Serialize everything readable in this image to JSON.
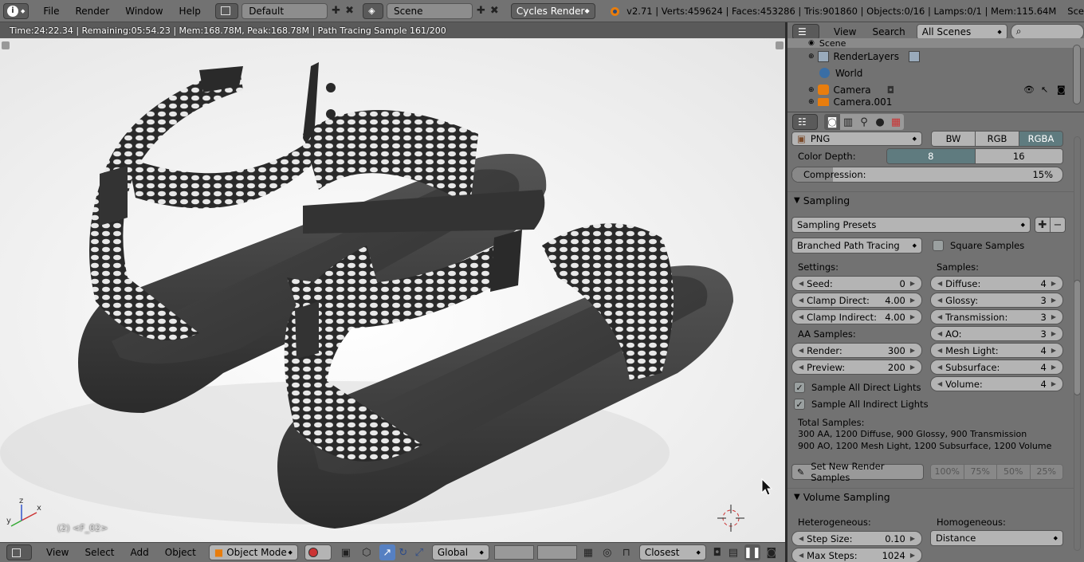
{
  "topbar": {
    "menus": [
      "File",
      "Render",
      "Window",
      "Help"
    ],
    "screen_layout": "Default",
    "scene": "Scene",
    "engine": "Cycles Render",
    "stats": "v2.71 | Verts:459624 | Faces:453286 | Tris:901860 | Objects:0/16 | Lamps:0/1 | Mem:115.64M",
    "right_cut": "Sce"
  },
  "viewport": {
    "info": "Time:24:22.34 | Remaining:05:54.23 | Mem:168.78M, Peak:168.78M | Path Tracing Sample 161/200",
    "object_label": "(2) <F_02>",
    "axis": {
      "x": "x",
      "y": "y",
      "z": "z"
    }
  },
  "footer": {
    "menus": [
      "View",
      "Select",
      "Add",
      "Object"
    ],
    "mode": "Object Mode",
    "orientation": "Global",
    "snap": "Closest"
  },
  "outliner": {
    "menus": [
      "View",
      "Search"
    ],
    "filter": "All Scenes",
    "rows": [
      "Scene",
      "RenderLayers",
      "World",
      "Camera",
      "Camera.001"
    ]
  },
  "properties": {
    "format": "PNG",
    "color_modes": [
      "BW",
      "RGB",
      "RGBA"
    ],
    "color_depth_label": "Color Depth:",
    "color_depths": [
      "8",
      "16"
    ],
    "compression_label": "Compression:",
    "compression_value": "15%",
    "sampling": {
      "title": "Sampling",
      "presets": "Sampling Presets",
      "method": "Branched Path Tracing",
      "square_samples": "Square Samples",
      "settings_label": "Settings:",
      "samples_label": "Samples:",
      "seed": {
        "label": "Seed:",
        "value": "0"
      },
      "clamp_direct": {
        "label": "Clamp Direct:",
        "value": "4.00"
      },
      "clamp_indirect": {
        "label": "Clamp Indirect:",
        "value": "4.00"
      },
      "aa_label": "AA Samples:",
      "render": {
        "label": "Render:",
        "value": "300"
      },
      "preview": {
        "label": "Preview:",
        "value": "200"
      },
      "diffuse": {
        "label": "Diffuse:",
        "value": "4"
      },
      "glossy": {
        "label": "Glossy:",
        "value": "3"
      },
      "transmission": {
        "label": "Transmission:",
        "value": "3"
      },
      "ao": {
        "label": "AO:",
        "value": "3"
      },
      "mesh_light": {
        "label": "Mesh Light:",
        "value": "4"
      },
      "subsurface": {
        "label": "Subsurface:",
        "value": "4"
      },
      "volume": {
        "label": "Volume:",
        "value": "4"
      },
      "sample_direct": "Sample All Direct Lights",
      "sample_indirect": "Sample All Indirect Lights",
      "total_label": "Total Samples:",
      "total_line1": "300 AA, 1200 Diffuse, 900 Glossy, 900 Transmission",
      "total_line2": "900 AO, 1200 Mesh Light, 1200 Subsurface, 1200 Volume",
      "set_button": "Set New Render Samples",
      "percents": [
        "100%",
        "75%",
        "50%",
        "25%"
      ]
    },
    "volume_sampling": {
      "title": "Volume Sampling",
      "hetero_label": "Heterogeneous:",
      "homo_label": "Homogeneous:",
      "step_size": {
        "label": "Step Size:",
        "value": "0.10"
      },
      "max_steps": {
        "label": "Max Steps:",
        "value": "1024"
      },
      "homo_value": "Distance"
    }
  }
}
